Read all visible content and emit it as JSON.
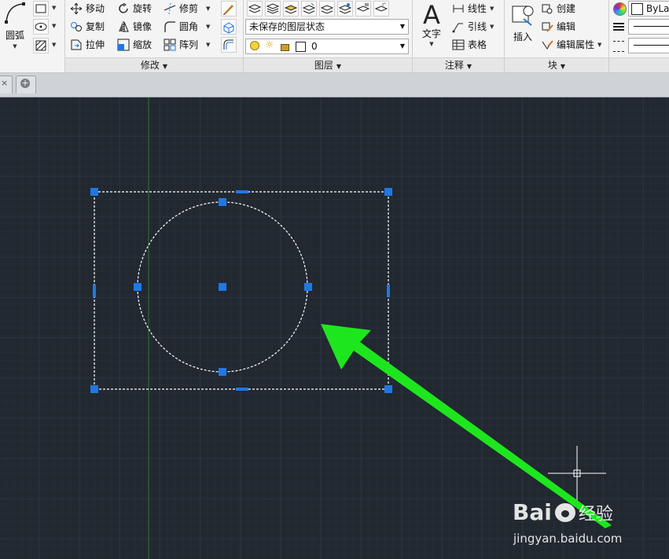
{
  "ribbon": {
    "draw_panel": {
      "arc_label": "圆弧"
    },
    "modify_panel": {
      "title": "修改",
      "commands": {
        "move": "移动",
        "rotate": "旋转",
        "trim": "修剪",
        "copy": "复制",
        "mirror": "镜像",
        "fillet": "圆角",
        "stretch": "拉伸",
        "scale": "缩放",
        "array": "阵列"
      }
    },
    "layer_panel": {
      "title": "图层",
      "layer_state": "未保存的图层状态",
      "current_layer": "0"
    },
    "annotation_panel": {
      "title": "注释",
      "text": "文字",
      "linear": "线性",
      "leader": "引线",
      "table": "表格"
    },
    "block_panel": {
      "title": "块",
      "insert": "插入",
      "create": "创建",
      "edit": "编辑",
      "edit_attributes": "编辑属性"
    },
    "properties_panel": {
      "color": "ByLay"
    }
  },
  "colors": {
    "canvas": "#212830",
    "grip": "#1e78e6",
    "arrow": "#1ee61e"
  },
  "watermark": {
    "brand": "Bai",
    "brand_tail": "经验",
    "url": "jingyan.baidu.com"
  }
}
